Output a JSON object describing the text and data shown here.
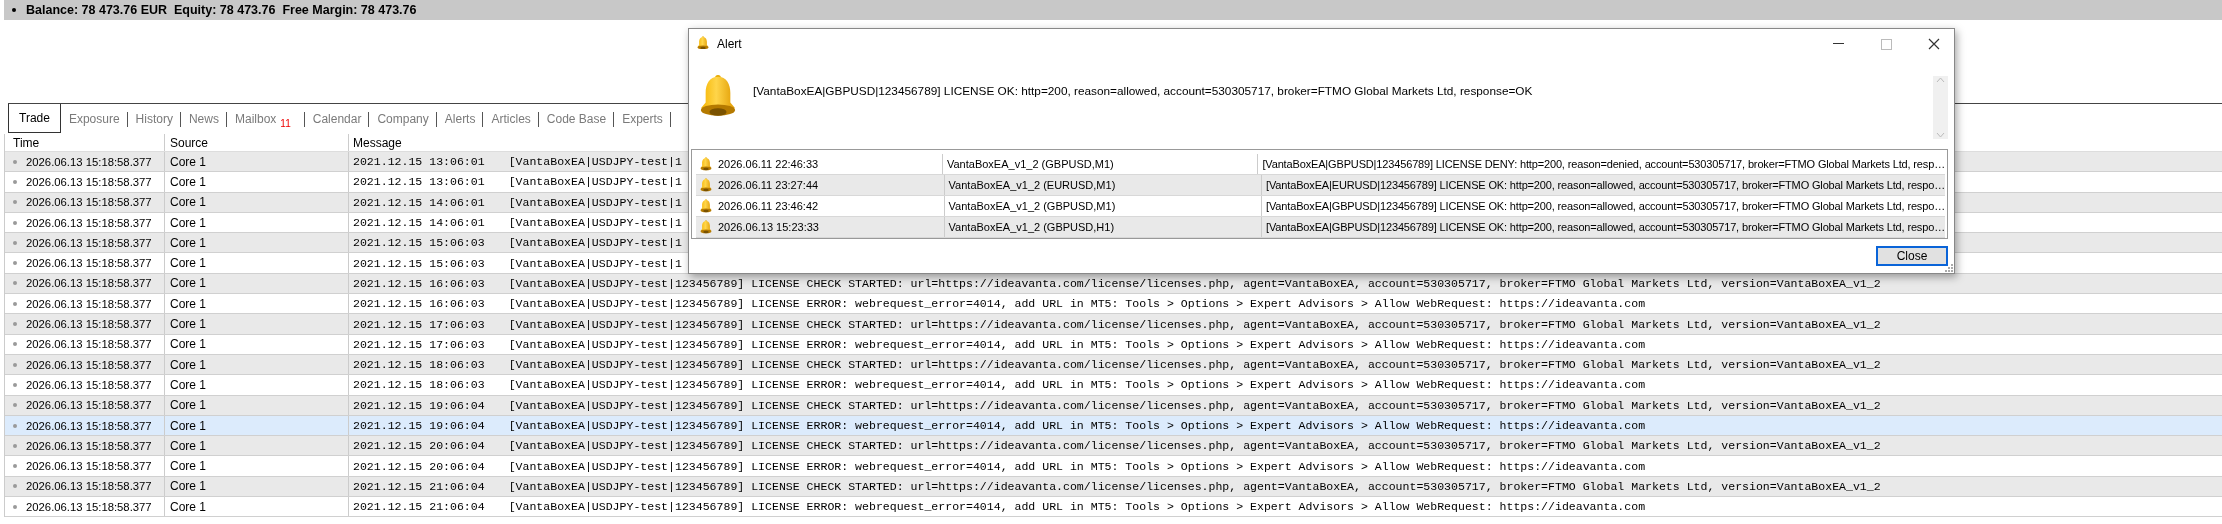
{
  "account_bar": {
    "text": "Balance: 78 473.76 EUR  Equity: 78 473.76  Free Margin: 78 473.76"
  },
  "tabs": [
    {
      "label": "Trade",
      "selected": true
    },
    {
      "label": "Exposure",
      "selected": false
    },
    {
      "label": "History",
      "selected": false
    },
    {
      "label": "News",
      "selected": false
    },
    {
      "label": "Mailbox",
      "selected": false,
      "badge": "11"
    },
    {
      "label": "Calendar",
      "selected": false
    },
    {
      "label": "Company",
      "selected": false
    },
    {
      "label": "Alerts",
      "selected": false
    },
    {
      "label": "Articles",
      "selected": false
    },
    {
      "label": "Code Base",
      "selected": false
    },
    {
      "label": "Experts",
      "selected": false
    }
  ],
  "log": {
    "columns": [
      "Time",
      "Source",
      "Message"
    ],
    "rows": [
      {
        "time": "2026.06.13 15:18:58.377",
        "source": "Core 1",
        "date": "2021.12.15 13:06:01",
        "message": "[VantaBoxEA|USDJPY-test|1",
        "selected": false
      },
      {
        "time": "2026.06.13 15:18:58.377",
        "source": "Core 1",
        "date": "2021.12.15 13:06:01",
        "message": "[VantaBoxEA|USDJPY-test|1",
        "selected": false
      },
      {
        "time": "2026.06.13 15:18:58.377",
        "source": "Core 1",
        "date": "2021.12.15 14:06:01",
        "message": "[VantaBoxEA|USDJPY-test|1",
        "selected": false
      },
      {
        "time": "2026.06.13 15:18:58.377",
        "source": "Core 1",
        "date": "2021.12.15 14:06:01",
        "message": "[VantaBoxEA|USDJPY-test|1",
        "selected": false
      },
      {
        "time": "2026.06.13 15:18:58.377",
        "source": "Core 1",
        "date": "2021.12.15 15:06:03",
        "message": "[VantaBoxEA|USDJPY-test|1",
        "selected": false
      },
      {
        "time": "2026.06.13 15:18:58.377",
        "source": "Core 1",
        "date": "2021.12.15 15:06:03",
        "message": "[VantaBoxEA|USDJPY-test|1",
        "selected": false
      },
      {
        "time": "2026.06.13 15:18:58.377",
        "source": "Core 1",
        "date": "2021.12.15 16:06:03",
        "message": "[VantaBoxEA|USDJPY-test|123456789] LICENSE CHECK STARTED: url=https://ideavanta.com/license/licenses.php, agent=VantaBoxEA, account=530305717, broker=FTMO Global Markets Ltd, version=VantaBoxEA_v1_2",
        "selected": false
      },
      {
        "time": "2026.06.13 15:18:58.377",
        "source": "Core 1",
        "date": "2021.12.15 16:06:03",
        "message": "[VantaBoxEA|USDJPY-test|123456789] LICENSE ERROR: webrequest_error=4014, add URL in MT5: Tools > Options > Expert Advisors > Allow WebRequest: https://ideavanta.com",
        "selected": false
      },
      {
        "time": "2026.06.13 15:18:58.377",
        "source": "Core 1",
        "date": "2021.12.15 17:06:03",
        "message": "[VantaBoxEA|USDJPY-test|123456789] LICENSE CHECK STARTED: url=https://ideavanta.com/license/licenses.php, agent=VantaBoxEA, account=530305717, broker=FTMO Global Markets Ltd, version=VantaBoxEA_v1_2",
        "selected": false
      },
      {
        "time": "2026.06.13 15:18:58.377",
        "source": "Core 1",
        "date": "2021.12.15 17:06:03",
        "message": "[VantaBoxEA|USDJPY-test|123456789] LICENSE ERROR: webrequest_error=4014, add URL in MT5: Tools > Options > Expert Advisors > Allow WebRequest: https://ideavanta.com",
        "selected": false
      },
      {
        "time": "2026.06.13 15:18:58.377",
        "source": "Core 1",
        "date": "2021.12.15 18:06:03",
        "message": "[VantaBoxEA|USDJPY-test|123456789] LICENSE CHECK STARTED: url=https://ideavanta.com/license/licenses.php, agent=VantaBoxEA, account=530305717, broker=FTMO Global Markets Ltd, version=VantaBoxEA_v1_2",
        "selected": false
      },
      {
        "time": "2026.06.13 15:18:58.377",
        "source": "Core 1",
        "date": "2021.12.15 18:06:03",
        "message": "[VantaBoxEA|USDJPY-test|123456789] LICENSE ERROR: webrequest_error=4014, add URL in MT5: Tools > Options > Expert Advisors > Allow WebRequest: https://ideavanta.com",
        "selected": false
      },
      {
        "time": "2026.06.13 15:18:58.377",
        "source": "Core 1",
        "date": "2021.12.15 19:06:04",
        "message": "[VantaBoxEA|USDJPY-test|123456789] LICENSE CHECK STARTED: url=https://ideavanta.com/license/licenses.php, agent=VantaBoxEA, account=530305717, broker=FTMO Global Markets Ltd, version=VantaBoxEA_v1_2",
        "selected": false
      },
      {
        "time": "2026.06.13 15:18:58.377",
        "source": "Core 1",
        "date": "2021.12.15 19:06:04",
        "message": "[VantaBoxEA|USDJPY-test|123456789] LICENSE ERROR: webrequest_error=4014, add URL in MT5: Tools > Options > Expert Advisors > Allow WebRequest: https://ideavanta.com",
        "selected": true
      },
      {
        "time": "2026.06.13 15:18:58.377",
        "source": "Core 1",
        "date": "2021.12.15 20:06:04",
        "message": "[VantaBoxEA|USDJPY-test|123456789] LICENSE CHECK STARTED: url=https://ideavanta.com/license/licenses.php, agent=VantaBoxEA, account=530305717, broker=FTMO Global Markets Ltd, version=VantaBoxEA_v1_2",
        "selected": false
      },
      {
        "time": "2026.06.13 15:18:58.377",
        "source": "Core 1",
        "date": "2021.12.15 20:06:04",
        "message": "[VantaBoxEA|USDJPY-test|123456789] LICENSE ERROR: webrequest_error=4014, add URL in MT5: Tools > Options > Expert Advisors > Allow WebRequest: https://ideavanta.com",
        "selected": false
      },
      {
        "time": "2026.06.13 15:18:58.377",
        "source": "Core 1",
        "date": "2021.12.15 21:06:04",
        "message": "[VantaBoxEA|USDJPY-test|123456789] LICENSE CHECK STARTED: url=https://ideavanta.com/license/licenses.php, agent=VantaBoxEA, account=530305717, broker=FTMO Global Markets Ltd, version=VantaBoxEA_v1_2",
        "selected": false
      },
      {
        "time": "2026.06.13 15:18:58.377",
        "source": "Core 1",
        "date": "2021.12.15 21:06:04",
        "message": "[VantaBoxEA|USDJPY-test|123456789] LICENSE ERROR: webrequest_error=4014, add URL in MT5: Tools > Options > Expert Advisors > Allow WebRequest: https://ideavanta.com",
        "selected": false
      }
    ]
  },
  "alert_dialog": {
    "title": "Alert",
    "message": "[VantaBoxEA|GBPUSD|123456789] LICENSE OK: http=200, reason=allowed, account=530305717, broker=FTMO Global Markets Ltd, response=OK",
    "alerts": [
      {
        "time": "2026.06.11 22:46:33",
        "expert": "VantaBoxEA_v1_2 (GBPUSD,M1)",
        "message": "[VantaBoxEA|GBPUSD|123456789] LICENSE DENY: http=200, reason=denied, account=530305717, broker=FTMO Global Markets Ltd, resp…"
      },
      {
        "time": "2026.06.11 23:27:44",
        "expert": "VantaBoxEA_v1_2 (EURUSD,M1)",
        "message": "[VantaBoxEA|EURUSD|123456789] LICENSE OK: http=200, reason=allowed, account=530305717, broker=FTMO Global Markets Ltd, respo…"
      },
      {
        "time": "2026.06.11 23:46:42",
        "expert": "VantaBoxEA_v1_2 (GBPUSD,M1)",
        "message": "[VantaBoxEA|GBPUSD|123456789] LICENSE OK: http=200, reason=allowed, account=530305717, broker=FTMO Global Markets Ltd, respo…"
      },
      {
        "time": "2026.06.13 15:23:33",
        "expert": "VantaBoxEA_v1_2 (GBPUSD,H1)",
        "message": "[VantaBoxEA|GBPUSD|123456789] LICENSE OK: http=200, reason=allowed, account=530305717, broker=FTMO Global Markets Ltd, respo…"
      }
    ],
    "close_button": "Close"
  }
}
